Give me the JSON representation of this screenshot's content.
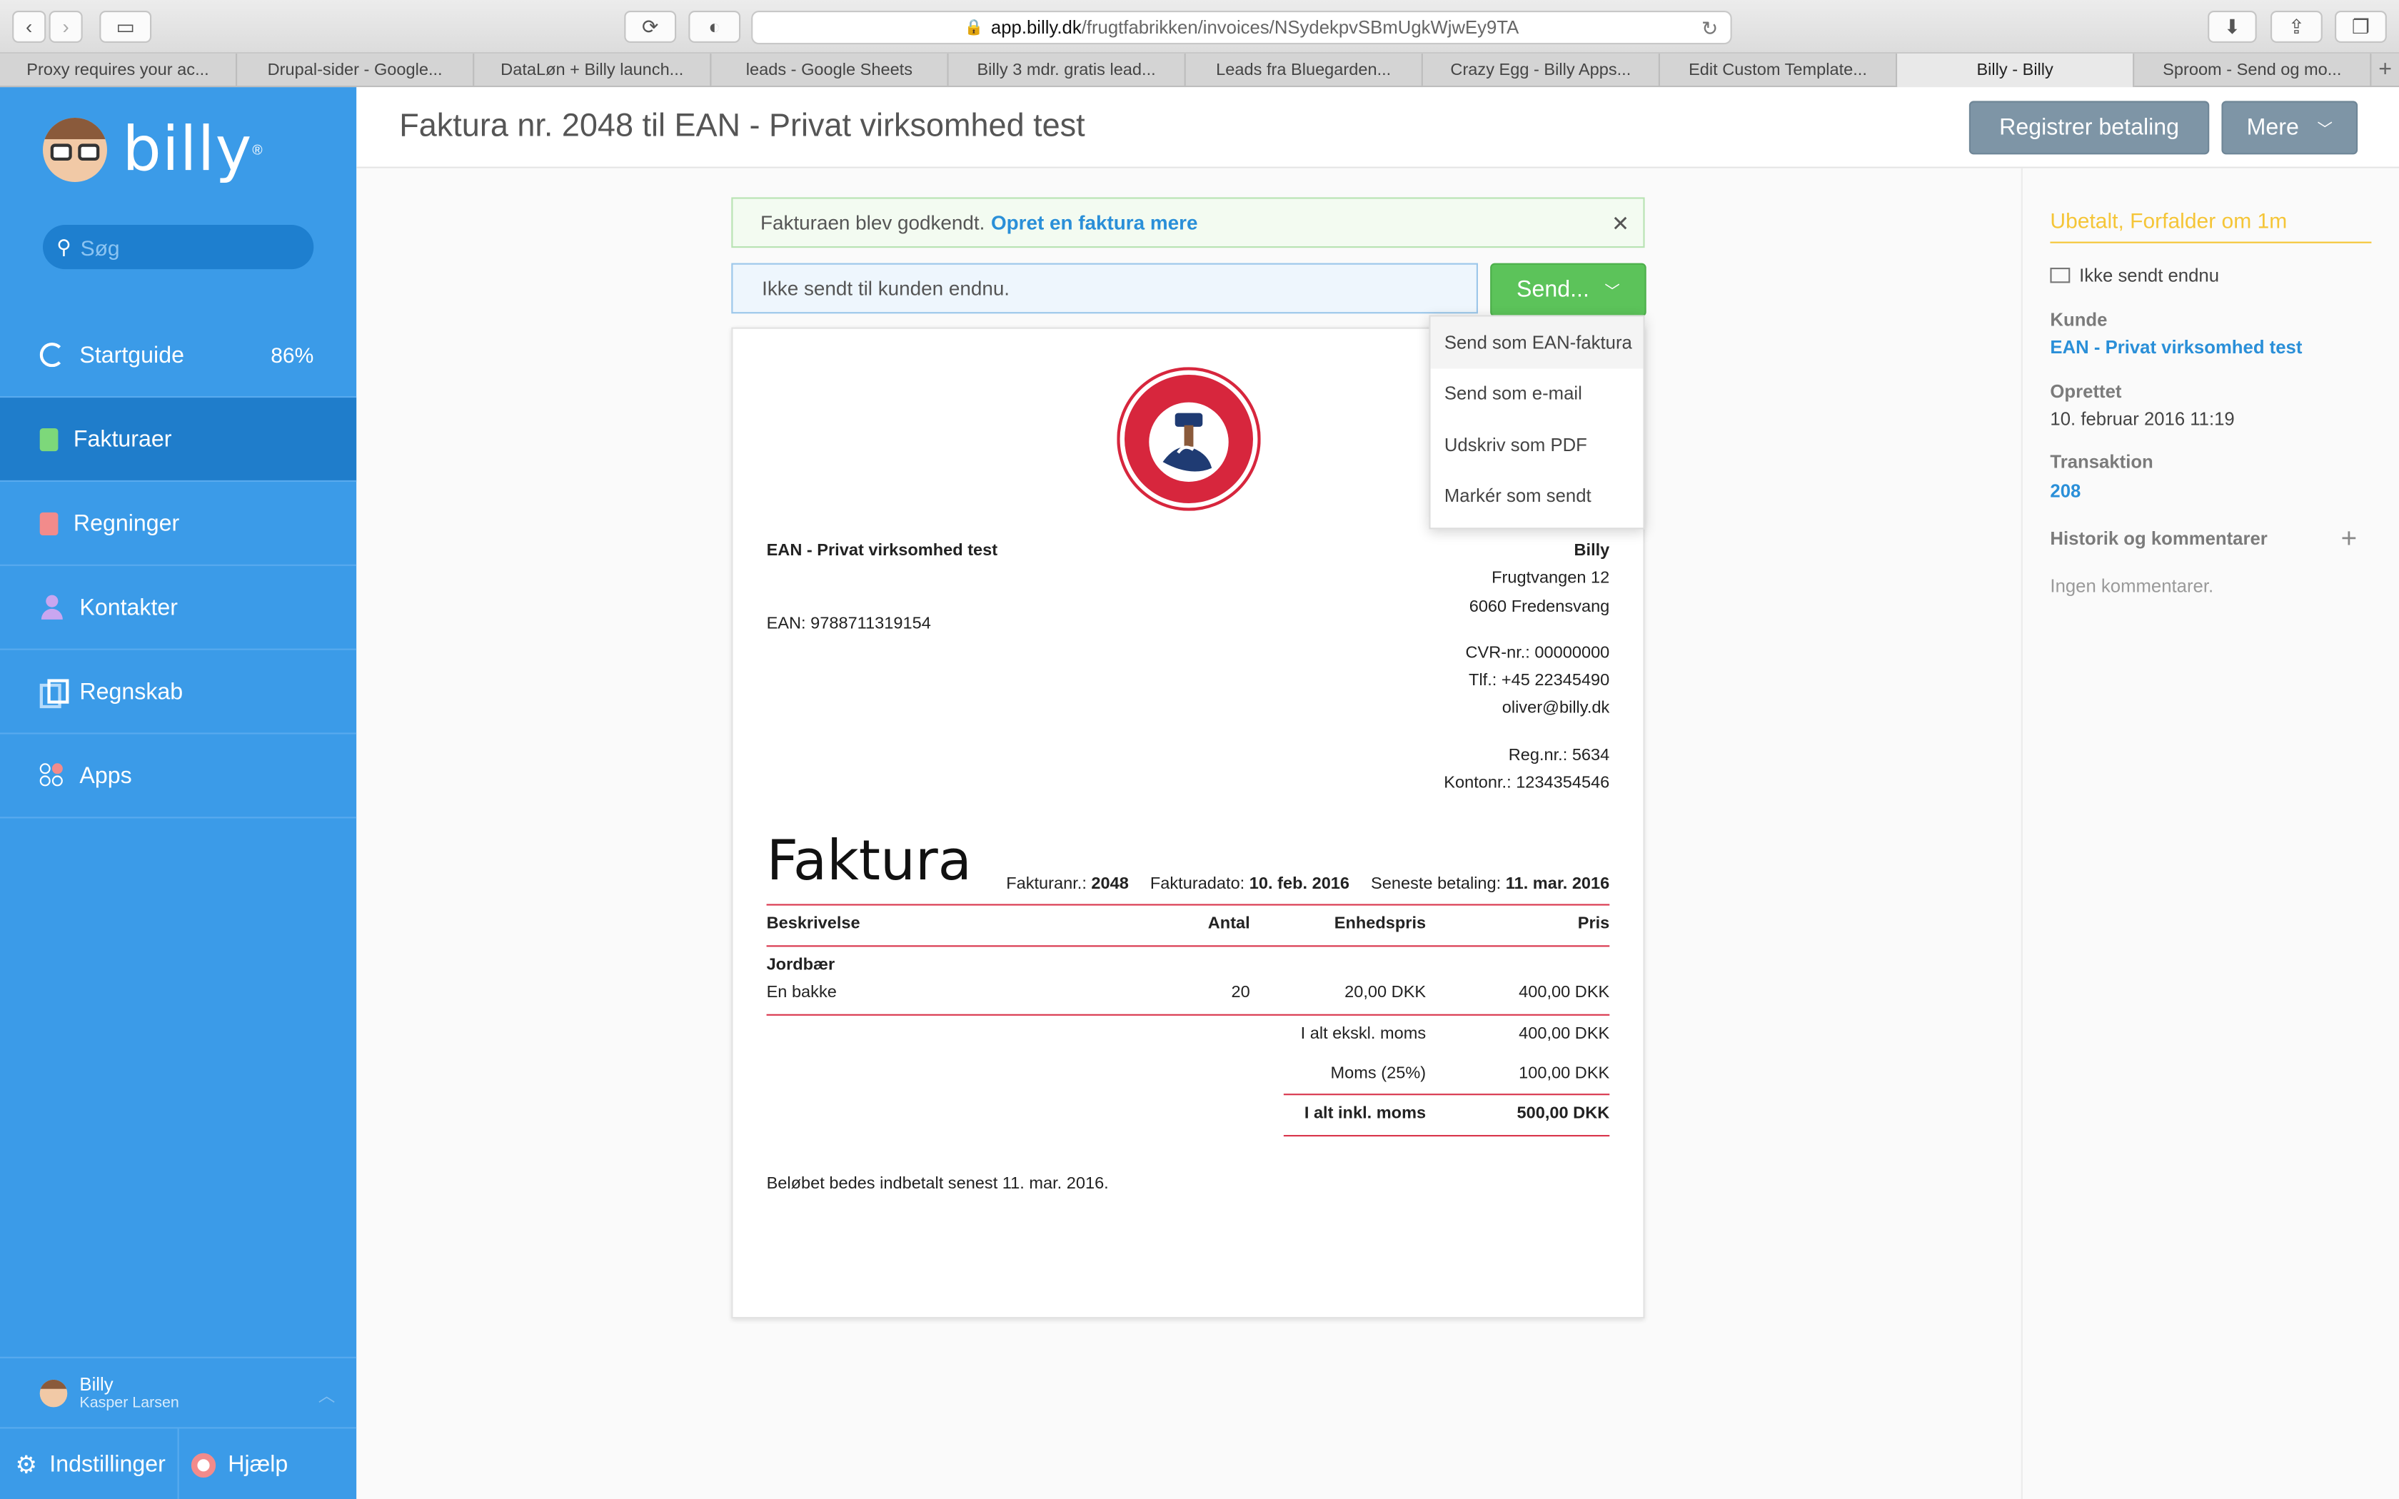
{
  "browser": {
    "url_host": "app.billy.dk",
    "url_path": "/frugtfabrikken/invoices/NSydekpvSBmUgkWjwEy9TA",
    "tabs": [
      "Proxy requires your ac...",
      "Drupal-sider - Google...",
      "DataLøn + Billy launch...",
      "leads - Google Sheets",
      "Billy 3 mdr. gratis lead...",
      "Leads fra Bluegarden...",
      "Crazy Egg - Billy Apps...",
      "Edit Custom Template...",
      "Billy - Billy",
      "Sproom - Send og mo..."
    ],
    "active_tab_index": 8
  },
  "sidebar": {
    "logo": "billy",
    "search_placeholder": "Søg",
    "items": [
      {
        "label": "Startguide",
        "badge": "86%"
      },
      {
        "label": "Fakturaer"
      },
      {
        "label": "Regninger"
      },
      {
        "label": "Kontakter"
      },
      {
        "label": "Regnskab"
      },
      {
        "label": "Apps"
      }
    ],
    "user": {
      "org": "Billy",
      "name": "Kasper Larsen"
    },
    "settings_label": "Indstillinger",
    "help_label": "Hjælp"
  },
  "header": {
    "title": "Faktura nr. 2048 til EAN - Privat virksomhed test",
    "register_payment": "Registrer betaling",
    "more": "Mere"
  },
  "notice": {
    "text": "Fakturaen blev godkendt.",
    "link": "Opret en faktura mere"
  },
  "send_status": "Ikke sendt til kunden endnu.",
  "send_button": "Send...",
  "send_menu": [
    "Send som EAN-faktura",
    "Send som e-mail",
    "Udskriv som PDF",
    "Markér som sendt"
  ],
  "invoice": {
    "customer": {
      "name": "EAN - Privat virksomhed test",
      "ean": "EAN: 9788711319154"
    },
    "company": {
      "name": "Billy",
      "address1": "Frugtvangen 12",
      "address2": "6060 Fredensvang",
      "cvr": "CVR-nr.: 00000000",
      "phone": "Tlf.: +45 22345490",
      "email": "oliver@billy.dk",
      "reg": "Reg.nr.: 5634",
      "account": "Kontonr.: 1234354546"
    },
    "heading": "Faktura",
    "number_label": "Fakturanr.:",
    "number": "2048",
    "date_label": "Fakturadato:",
    "date": "10. feb. 2016",
    "due_label": "Seneste betaling:",
    "due": "11. mar. 2016",
    "columns": {
      "desc": "Beskrivelse",
      "qty": "Antal",
      "unit": "Enhedspris",
      "price": "Pris"
    },
    "line": {
      "product": "Jordbær",
      "desc": "En bakke",
      "qty": "20",
      "unit": "20,00 DKK",
      "price": "400,00 DKK"
    },
    "totals": {
      "excl_label": "I alt ekskl. moms",
      "excl": "400,00 DKK",
      "vat_label": "Moms (25%)",
      "vat": "100,00 DKK",
      "incl_label": "I alt inkl. moms",
      "incl": "500,00 DKK"
    },
    "footnote": "Beløbet bedes indbetalt senest 11. mar. 2016."
  },
  "panel": {
    "status": "Ubetalt, Forfalder om 1m",
    "sent": "Ikke sendt endnu",
    "customer_label": "Kunde",
    "customer": "EAN - Privat virksomhed test",
    "created_label": "Oprettet",
    "created": "10. februar 2016 11:19",
    "transaction_label": "Transaktion",
    "transaction": "208",
    "history_label": "Historik og kommentarer",
    "no_comments": "Ingen kommentarer."
  },
  "colors": {
    "sidebar": "#3b9be8",
    "sidebar_active": "#1f7dcb",
    "send": "#5cc35a",
    "accent_red": "#d9364d",
    "status_yellow": "#f5c537",
    "link": "#2a8fd8"
  }
}
